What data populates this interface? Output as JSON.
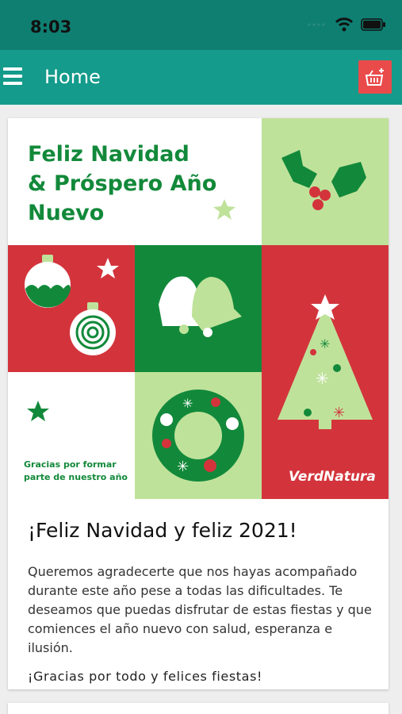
{
  "status": {
    "time": "8:03"
  },
  "appbar": {
    "title": "Home"
  },
  "banner": {
    "headline_line1": "Feliz Navidad",
    "headline_line2": "& Próspero Año",
    "headline_line3": "Nuevo",
    "thanks_line1": "Gracias por formar",
    "thanks_line2": "parte de nuestro año",
    "brand": "VerdNatura"
  },
  "post": {
    "title": "¡Feliz Navidad y feliz 2021!",
    "body": "Queremos agradecerte que nos hayas acompañado durante este año pese a todas las dificultades. Te deseamos que puedas disfrutar de estas fiestas y que comiences el año nuevo con salud, esperanza e ilusión.",
    "closing": "¡Gracias por todo y felices fiestas!"
  },
  "colors": {
    "statusbar": "#0f7f72",
    "appbar": "#149b8b",
    "basket": "#e94b4b",
    "green": "#12893a",
    "lightgreen": "#bfe29b",
    "red": "#d3343c"
  },
  "icons": {
    "menu": "hamburger-icon",
    "basket": "shopping-basket-icon",
    "wifi": "wifi-icon",
    "battery": "battery-icon",
    "signal": "signal-icon"
  }
}
